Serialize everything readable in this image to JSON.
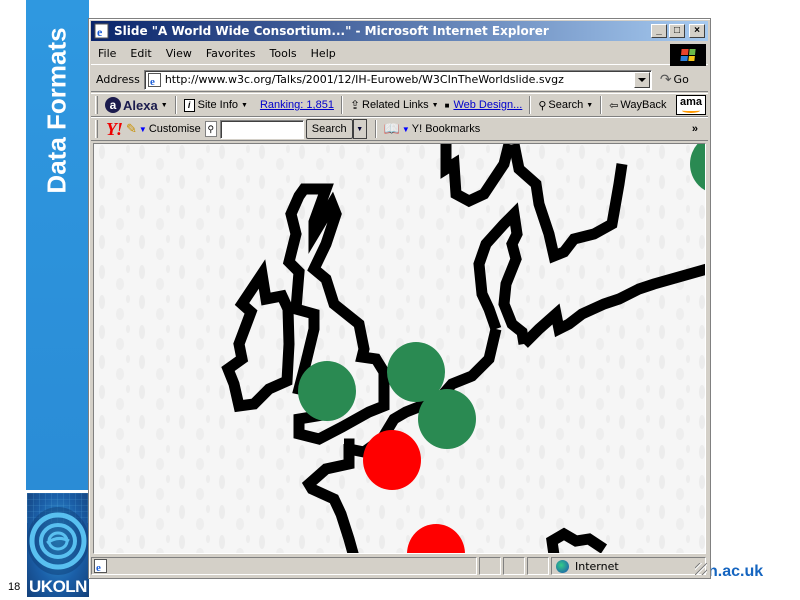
{
  "slide": {
    "side_title": "Data Formats",
    "slide_number": "18",
    "logo_text": "UKOLN",
    "footer_url_fragment": "n.ac.uk",
    "colors": {
      "sidebar": "#2f98e0",
      "footer_link": "#1565c0"
    }
  },
  "browser": {
    "title": "Slide \"A World Wide Consortium...\" - Microsoft Internet Explorer",
    "window_buttons": {
      "minimize": "_",
      "maximize": "□",
      "close": "×"
    },
    "menu": [
      "File",
      "Edit",
      "View",
      "Favorites",
      "Tools",
      "Help"
    ],
    "address": {
      "label": "Address",
      "url": "http://www.w3c.org/Talks/2001/12/IH-Euroweb/W3CInTheWorldslide.svgz",
      "go_label": "Go"
    },
    "alexa_toolbar": {
      "brand": "Alexa",
      "site_info": "Site Info",
      "ranking": "Ranking: 1,851",
      "related_links": "Related Links",
      "web_design": "Web Design...",
      "search": "Search",
      "wayback": "WayBack",
      "amazon": "ama"
    },
    "yahoo_toolbar": {
      "brand": "Y!",
      "customise": "Customise",
      "search_value": "",
      "search_button": "Search",
      "bookmarks": "Y! Bookmarks",
      "more": "»"
    },
    "status": {
      "zone": "Internet"
    }
  },
  "map": {
    "description": "SVG map of western Europe with W3C member markers",
    "marker_colors": {
      "green": "#2a8a52",
      "red": "#ff0000",
      "outline": "#000000",
      "background": "#f4f4f4"
    },
    "markers": [
      {
        "color": "green",
        "region": "UK (Oxford/London)"
      },
      {
        "color": "green",
        "region": "Netherlands (Amsterdam)"
      },
      {
        "color": "green",
        "region": "Germany (west)"
      },
      {
        "color": "red",
        "region": "France (Paris)"
      },
      {
        "color": "red",
        "region": "France (south)"
      },
      {
        "color": "green",
        "region": "Scandinavia"
      }
    ]
  }
}
